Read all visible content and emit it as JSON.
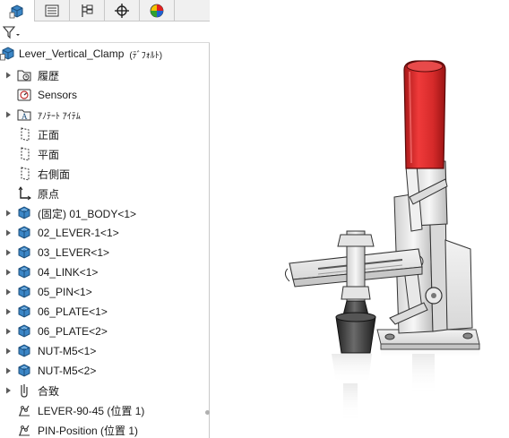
{
  "tabs": [
    {
      "icon": "feature-manager-icon",
      "active": true
    },
    {
      "icon": "property-manager-icon",
      "active": false
    },
    {
      "icon": "configuration-manager-icon",
      "active": false
    },
    {
      "icon": "dimxpert-manager-icon",
      "active": false
    },
    {
      "icon": "display-manager-icon",
      "active": false
    }
  ],
  "filter": {
    "icon": "filter-icon"
  },
  "tree": {
    "root": {
      "label": "Lever_Vertical_Clamp",
      "config": "(ﾃﾞﾌｫﾙﾄ)",
      "icon": "assembly-icon"
    },
    "items": [
      {
        "label": "履歴",
        "icon": "history-folder-icon",
        "expandable": true
      },
      {
        "label": "Sensors",
        "icon": "sensors-icon",
        "expandable": false
      },
      {
        "label": "ｱﾉﾃｰﾄ ｱｲﾃﾑ",
        "icon": "annotations-icon",
        "expandable": true
      },
      {
        "label": "正面",
        "icon": "plane-icon",
        "expandable": false
      },
      {
        "label": "平面",
        "icon": "plane-icon",
        "expandable": false
      },
      {
        "label": "右側面",
        "icon": "plane-icon",
        "expandable": false
      },
      {
        "label": "原点",
        "icon": "origin-icon",
        "expandable": false
      },
      {
        "label": "(固定) 01_BODY<1>",
        "icon": "part-icon",
        "expandable": true
      },
      {
        "label": "02_LEVER-1<1>",
        "icon": "part-icon",
        "expandable": true
      },
      {
        "label": "03_LEVER<1>",
        "icon": "part-icon",
        "expandable": true
      },
      {
        "label": "04_LINK<1>",
        "icon": "part-icon",
        "expandable": true
      },
      {
        "label": "05_PIN<1>",
        "icon": "part-icon",
        "expandable": true
      },
      {
        "label": "06_PLATE<1>",
        "icon": "part-icon",
        "expandable": true
      },
      {
        "label": "06_PLATE<2>",
        "icon": "part-icon",
        "expandable": true
      },
      {
        "label": "NUT-M5<1>",
        "icon": "part-icon",
        "expandable": true
      },
      {
        "label": "NUT-M5<2>",
        "icon": "part-icon",
        "expandable": true
      },
      {
        "label": "合致",
        "icon": "mates-icon",
        "expandable": true
      },
      {
        "label": "LEVER-90-45 (位置 1)",
        "icon": "motion-study-icon",
        "expandable": false
      },
      {
        "label": "PIN-Position (位置 1)",
        "icon": "motion-study-icon",
        "expandable": false
      }
    ]
  },
  "colors": {
    "part_blue": "#2a7ab8",
    "handle_red": "#d62a2a",
    "panel_border": "#c8c8c8"
  }
}
